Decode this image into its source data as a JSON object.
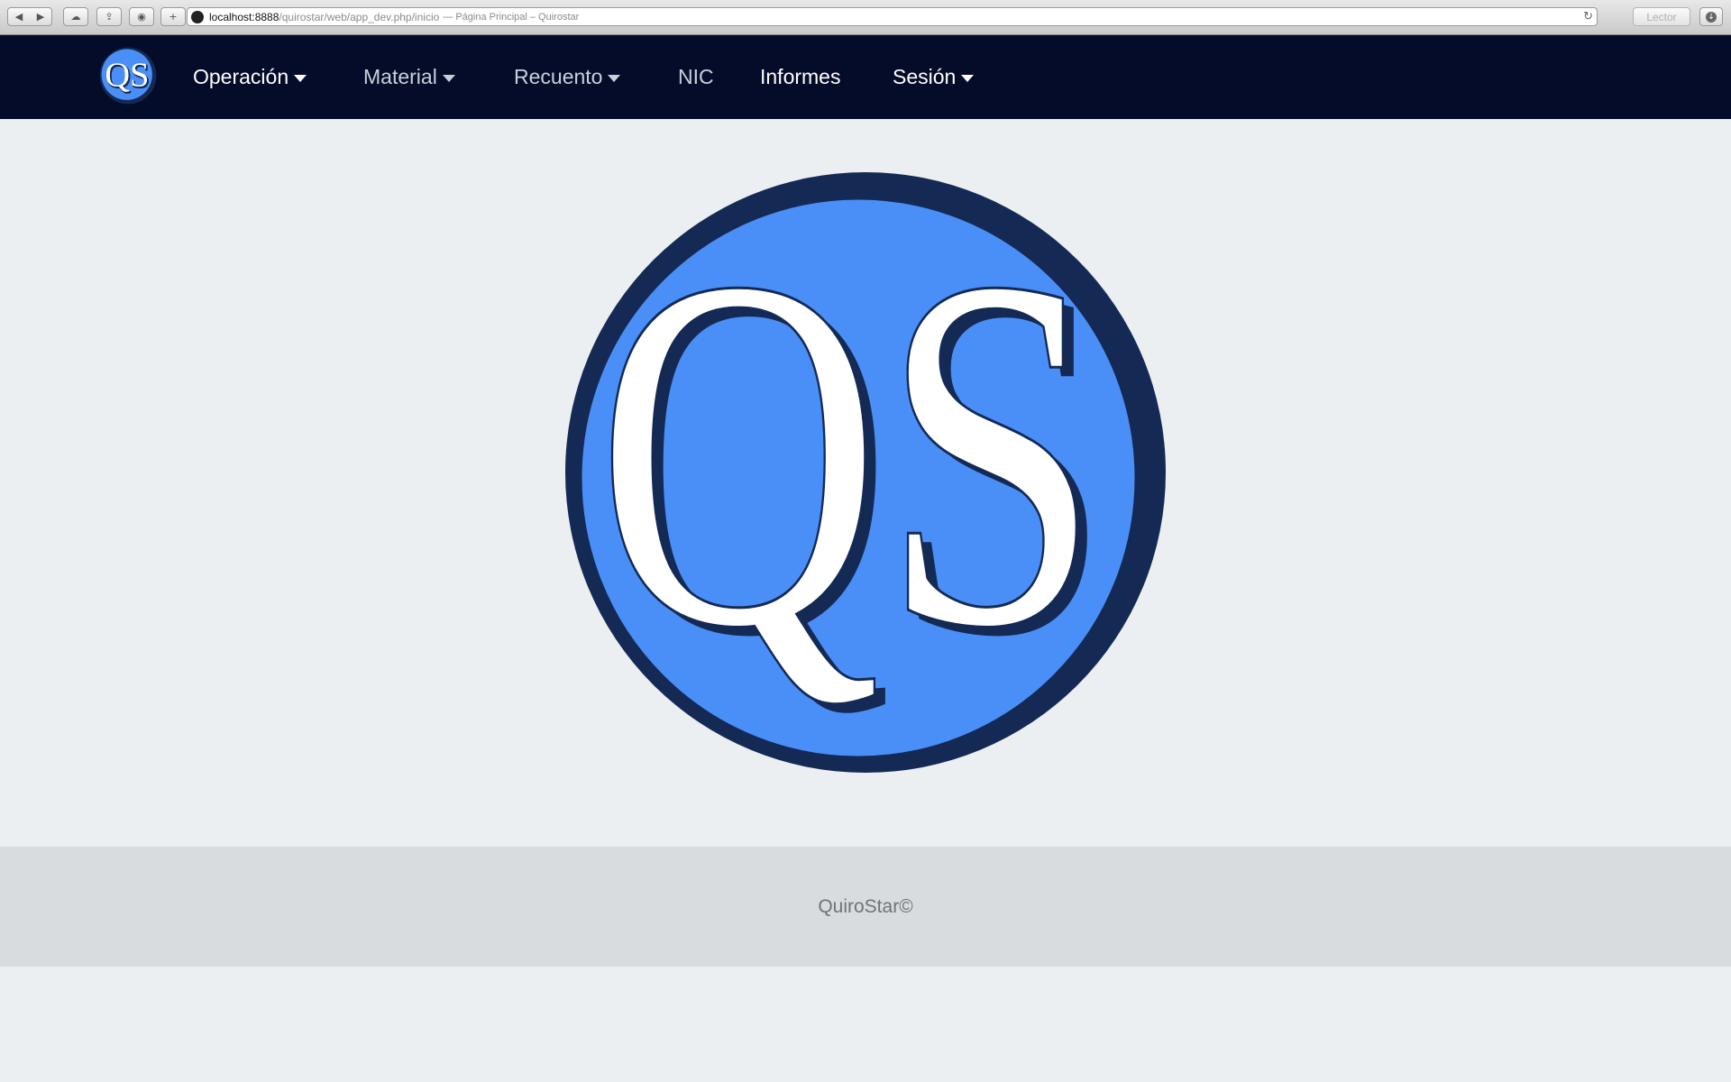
{
  "browser": {
    "url_host": "localhost:8888",
    "url_path": "/quirostar/web/app_dev.php/inicio",
    "tab_title": "— Página Principal – Quirostar",
    "reader_label": "Lector",
    "icons": [
      "back-icon",
      "forward-icon",
      "icloud-icon",
      "share-icon",
      "topsites-icon",
      "new-tab-icon",
      "reload-icon",
      "downloads-icon"
    ]
  },
  "navbar": {
    "brand_text": "QS",
    "items": [
      {
        "label": "Operación",
        "dropdown": true
      },
      {
        "label": "Material",
        "dropdown": true
      },
      {
        "label": "Recuento",
        "dropdown": true
      },
      {
        "label": "NIC",
        "dropdown": false
      },
      {
        "label": "Informes",
        "dropdown": false
      },
      {
        "label": "Sesión",
        "dropdown": true
      }
    ]
  },
  "main": {
    "logo_text": "QS"
  },
  "footer": {
    "text": "QuiroStar©"
  },
  "colors": {
    "navbar_bg": "#050c2a",
    "logo_blue": "#4a8ff7",
    "logo_ring": "#142a55",
    "page_bg": "#eceff1",
    "footer_bg": "#d8dcdf"
  }
}
